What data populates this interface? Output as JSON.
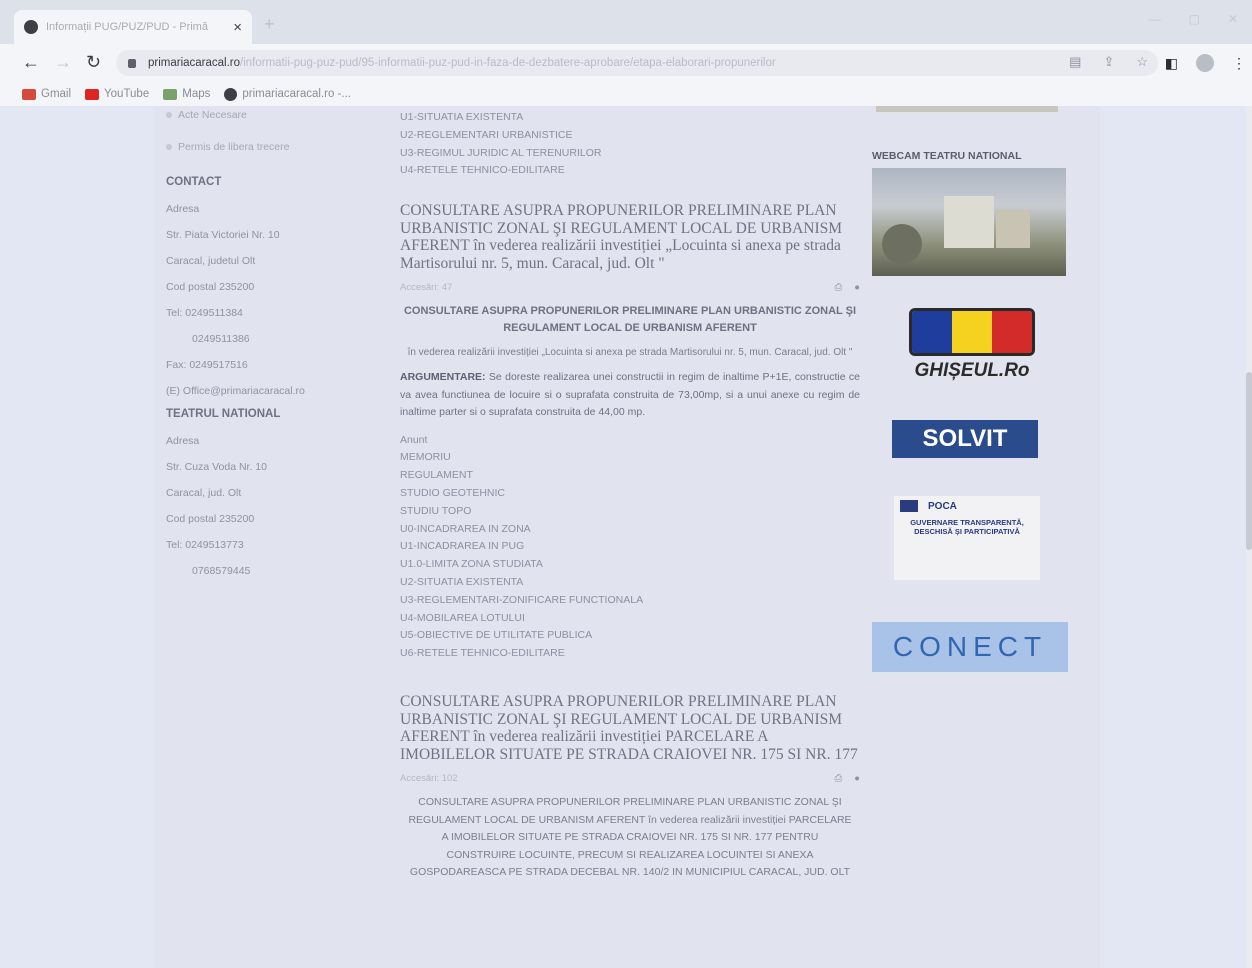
{
  "browser": {
    "tab_title": "Informații PUG/PUZ/PUD - Primă",
    "tab_close": "×",
    "new_tab": "+",
    "url_domain": "primariacaracal.ro",
    "url_path": "/informatii-pug-puz-pud/95-informatii-puz-pud-in-faza-de-dezbatere-aprobare/etapa-elaborari-propunerilor",
    "bookmarks": [
      "Gmail",
      "YouTube",
      "Maps",
      "primariacaracal.ro -..."
    ]
  },
  "sidebar": {
    "link_acte": "Acte Necesare",
    "link_permis": "Permis de libera trecere",
    "contact_heading": "CONTACT",
    "contact": {
      "adresa": "Adresa",
      "street": "Str. Piata Victoriei Nr. 10",
      "city": "Caracal, judetul Olt",
      "postal": "Cod postal 235200",
      "tel1": "Tel: 0249511384",
      "tel2": "0249511386",
      "fax": "Fax: 0249517516",
      "email": "(E) Office@primariacaracal.ro"
    },
    "theatre_heading": "TEATRUL NATIONAL",
    "theatre": {
      "adresa": "Adresa",
      "street": "Str. Cuza Voda Nr. 10",
      "city": "Caracal, jud. Olt",
      "postal": "Cod postal 235200",
      "tel1": "Tel: 0249513773",
      "tel2": "0768579445"
    }
  },
  "main": {
    "top_list": [
      "U1-SITUATIA EXISTENTA",
      "U2-REGLEMENTARI URBANISTICE",
      "U3-REGIMUL JURIDIC AL TERENURILOR",
      "U4-RETELE TEHNICO-EDILITARE"
    ],
    "article1": {
      "title": "CONSULTARE ASUPRA PROPUNERILOR PRELIMINARE PLAN URBANISTIC ZONAL ŞI REGULAMENT LOCAL DE URBANISM AFERENT în vederea realizării investiției „Locuinta si anexa pe strada Martisorului nr. 5, mun. Caracal, jud. Olt \"",
      "hits": "Accesări: 47",
      "heading": "CONSULTARE ASUPRA PROPUNERILOR PRELIMINARE PLAN URBANISTIC ZONAL ŞI REGULAMENT LOCAL DE URBANISM AFERENT",
      "subheading": "în vederea realizării investiției „Locuinta si anexa pe strada Martisorului nr. 5, mun. Caracal, jud. Olt \"",
      "arg_label": "ARGUMENTARE:",
      "arg_text": "Se doreste realizarea unei constructii in regim de inaltime P+1E, constructie ce va avea functiunea de locuire si o suprafata construita de 73,00mp, si a unui anexe cu regim de inaltime parter si o suprafata construita de 44,00 mp.",
      "files": [
        "Anunt",
        "MEMORIU",
        "REGULAMENT",
        "STUDIO GEOTEHNIC",
        "STUDIU TOPO",
        "U0-INCADRAREA IN ZONA",
        "U1-INCADRAREA IN PUG",
        "U1.0-LIMITA ZONA STUDIATA",
        "U2-SITUATIA EXISTENTA",
        "U3-REGLEMENTARI-ZONIFICARE FUNCTIONALA",
        "U4-MOBILAREA LOTULUI",
        "U5-OBIECTIVE DE UTILITATE PUBLICA",
        "U6-RETELE TEHNICO-EDILITARE"
      ]
    },
    "article2": {
      "title": "CONSULTARE ASUPRA PROPUNERILOR PRELIMINARE PLAN URBANISTIC ZONAL ŞI REGULAMENT LOCAL DE URBANISM AFERENT în vederea realizării investiției PARCELARE A IMOBILELOR SITUATE PE STRADA CRAIOVEI NR. 175 SI NR. 177",
      "hits": "Accesări: 102",
      "body": "CONSULTARE ASUPRA PROPUNERILOR PRELIMINARE PLAN URBANISTIC ZONAL ŞI REGULAMENT LOCAL DE URBANISM AFERENT în vederea realizării investiției PARCELARE A IMOBILELOR SITUATE PE STRADA CRAIOVEI NR. 175 SI NR. 177 PENTRU CONSTRUIRE LOCUINTE, PRECUM SI REALIZAREA LOCUINTEI SI ANEXA GOSPODAREASCA PE STRADA DECEBAL NR. 140/2 IN MUNICIPIUL CARACAL, JUD. OLT"
    }
  },
  "right": {
    "webcam_label": "WEBCAM TEATRU NATIONAL",
    "ghiseul": "GHIȘEUL.Ro",
    "solvit": "SOLVIT",
    "poca": "POCA",
    "poca_line": "GUVERNARE TRANSPARENTĂ, DESCHISĂ ȘI PARTICIPATIVĂ",
    "conect": "CONECT"
  },
  "colors": {
    "ghiseul_blue": "#1f3d9c",
    "ghiseul_yellow": "#f4d21f",
    "ghiseul_red": "#d32a2a"
  }
}
